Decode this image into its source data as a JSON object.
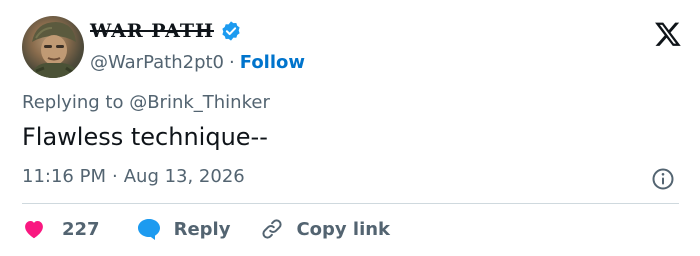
{
  "author": {
    "display_name": "WAR PATH",
    "handle": "@WarPath2pt0",
    "separator": "·",
    "follow_label": "Follow",
    "verified_color": "#1d9bf0"
  },
  "tweet": {
    "replying_to": "Replying to @Brink_Thinker",
    "text": "Flawless technique--",
    "time": "11:16 PM",
    "date_separator": "·",
    "date": "Aug 13, 2026"
  },
  "actions": {
    "likes_count": "227",
    "reply_label": "Reply",
    "copy_link_label": "Copy link"
  },
  "colors": {
    "heart": "#f91880",
    "reply_bubble": "#1d9bf0",
    "follow_link": "#0074cc",
    "secondary_text": "#536471"
  },
  "icons": {
    "platform": "x-logo-icon",
    "verified": "verified-badge-icon",
    "info": "info-icon",
    "like": "heart-icon",
    "reply": "reply-bubble-icon",
    "copy": "link-icon"
  }
}
